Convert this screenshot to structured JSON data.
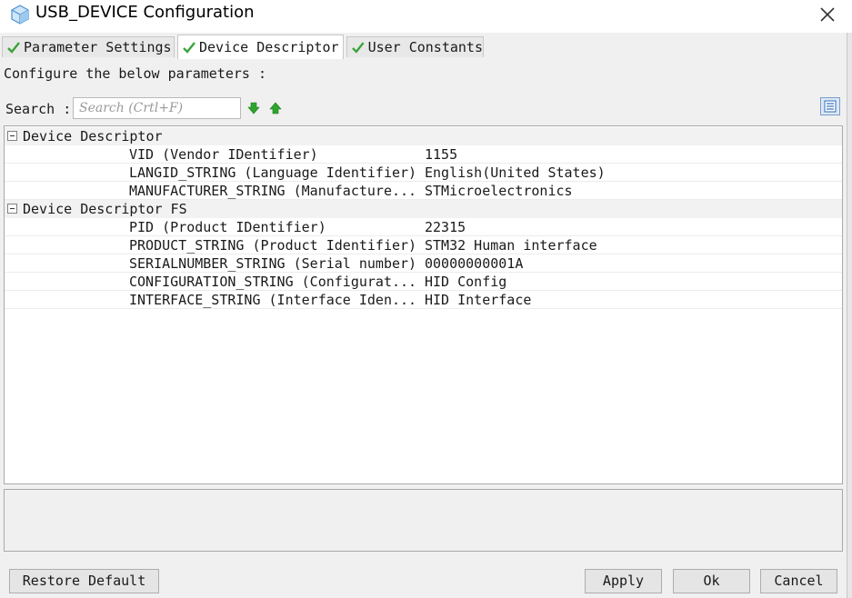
{
  "window": {
    "title": "USB_DEVICE Configuration"
  },
  "tabs": [
    {
      "label": "Parameter Settings",
      "active": false
    },
    {
      "label": "Device Descriptor",
      "active": true
    },
    {
      "label": "User Constants",
      "active": false
    }
  ],
  "intro_text": "Configure the below parameters :",
  "search": {
    "label": "Search :",
    "placeholder": "Search (Crtl+F)"
  },
  "groups": [
    {
      "label": "Device Descriptor",
      "params": [
        {
          "name": "VID (Vendor IDentifier)",
          "value": "1155"
        },
        {
          "name": "LANGID_STRING (Language Identifier)",
          "value": "English(United States)"
        },
        {
          "name": "MANUFACTURER_STRING (Manufacture...",
          "value": "STMicroelectronics"
        }
      ]
    },
    {
      "label": "Device Descriptor FS",
      "params": [
        {
          "name": "PID (Product IDentifier)",
          "value": "22315"
        },
        {
          "name": "PRODUCT_STRING (Product Identifier)",
          "value": "STM32 Human interface"
        },
        {
          "name": "SERIALNUMBER_STRING (Serial number)",
          "value": "00000000001A"
        },
        {
          "name": "CONFIGURATION_STRING (Configurat...",
          "value": "HID Config"
        },
        {
          "name": "INTERFACE_STRING (Interface Iden...",
          "value": "HID Interface"
        }
      ]
    }
  ],
  "buttons": {
    "restore": "Restore Default",
    "apply": "Apply",
    "ok": "Ok",
    "cancel": "Cancel"
  },
  "colors": {
    "check": "#3aa33a",
    "arrow": "#2fa52f",
    "accent": "#2f6db5"
  }
}
